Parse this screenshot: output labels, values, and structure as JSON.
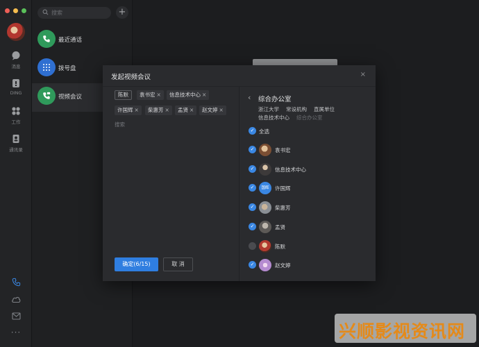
{
  "window": {
    "traffic_lights": [
      "#ee5f57",
      "#f5bd4f",
      "#5ac05a"
    ]
  },
  "rail": {
    "items": [
      {
        "icon": "message-icon",
        "label": "消息"
      },
      {
        "icon": "ding-icon",
        "label": "DING"
      },
      {
        "icon": "apps-grid-icon",
        "label": "工作"
      },
      {
        "icon": "contacts-icon",
        "label": "通讯录"
      }
    ],
    "bottom_icons": [
      "phone-icon",
      "cloud-icon",
      "mail-icon",
      "more-icon"
    ]
  },
  "mid": {
    "search_placeholder": "搜索",
    "items": [
      {
        "label": "最近通话",
        "color": "#2f9a5b",
        "icon": "recent-calls-icon"
      },
      {
        "label": "拨号盘",
        "color": "#2f6fd1",
        "icon": "dialpad-icon"
      },
      {
        "label": "视频会议",
        "color": "#2f9a5b",
        "icon": "video-meeting-icon"
      }
    ]
  },
  "dialog": {
    "title": "发起视频会议",
    "close": "×",
    "selected_tags": [
      {
        "label": "陈默"
      },
      {
        "label": "袁书宏"
      },
      {
        "label": "信息技术中心"
      },
      {
        "label": "许国辉"
      },
      {
        "label": "柴惠芳"
      },
      {
        "label": "孟贤"
      },
      {
        "label": "赵文婷"
      }
    ],
    "remove_mark": "×",
    "search_placeholder": "搜索",
    "confirm_label": "确定(6/15)",
    "cancel_label": "取 消",
    "org": {
      "title": "综合办公室",
      "breadcrumb": [
        "浙江大学",
        "常设机构",
        "直属单位",
        "信息技术中心",
        "综合办公室"
      ],
      "select_all": "全选",
      "members": [
        {
          "name": "袁书宏",
          "checked": true
        },
        {
          "name": "信息技术中心",
          "checked": true
        },
        {
          "name": "许国辉",
          "checked": true,
          "avatar_text": "国辉"
        },
        {
          "name": "柴惠芳",
          "checked": true
        },
        {
          "name": "孟贤",
          "checked": true
        },
        {
          "name": "陈默",
          "checked": false
        },
        {
          "name": "赵文婷",
          "checked": true
        }
      ]
    }
  },
  "watermark": {
    "text": "兴顺影视资讯网"
  }
}
